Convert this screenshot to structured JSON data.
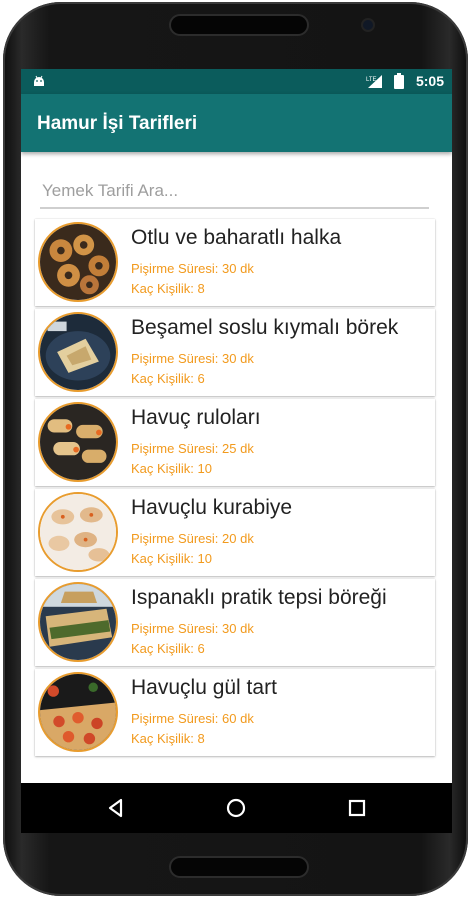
{
  "status_bar": {
    "time": "5:05",
    "network_label": "LTE"
  },
  "app_bar": {
    "title": "Hamur İşi Tarifleri"
  },
  "search": {
    "placeholder": "Yemek Tarifi Ara..."
  },
  "recipes": [
    {
      "name": "Otlu ve baharatlı halka",
      "time": "Pişirme Süresi: 30 dk",
      "servings": "Kaç Kişilik: 8"
    },
    {
      "name": "Beşamel soslu kıymalı börek",
      "time": "Pişirme Süresi: 30 dk",
      "servings": "Kaç Kişilik: 6"
    },
    {
      "name": "Havuç ruloları",
      "time": "Pişirme Süresi: 25 dk",
      "servings": "Kaç Kişilik: 10"
    },
    {
      "name": "Havuçlu kurabiye",
      "time": "Pişirme Süresi: 20 dk",
      "servings": "Kaç Kişilik: 10"
    },
    {
      "name": "Ispanaklı pratik tepsi böreği",
      "time": "Pişirme Süresi: 30 dk",
      "servings": "Kaç Kişilik: 6"
    },
    {
      "name": "Havuçlu gül tart",
      "time": "Pişirme Süresi: 60 dk",
      "servings": "Kaç Kişilik: 8"
    }
  ],
  "nav": {
    "back": "back-icon",
    "home": "home-icon",
    "recents": "recents-icon"
  },
  "colors": {
    "status_bar": "#0b5c5c",
    "app_bar": "#137373",
    "accent_text": "#f29a1d",
    "thumb_border": "#e89c2e"
  }
}
